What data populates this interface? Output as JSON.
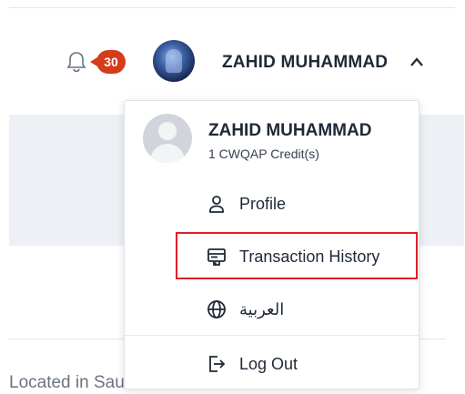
{
  "header": {
    "notification_count": "30",
    "user_name": "ZAHID MUHAMMAD"
  },
  "dropdown": {
    "user_name": "ZAHID MUHAMMAD",
    "credits": "1 CWQAP Credit(s)",
    "items": [
      {
        "label": "Profile",
        "icon": "person-icon"
      },
      {
        "label": "Transaction History",
        "icon": "receipt-icon",
        "highlighted": true
      },
      {
        "label": "العربية",
        "icon": "globe-icon"
      },
      {
        "label": "Log Out",
        "icon": "logout-icon"
      }
    ]
  },
  "background": {
    "location_text": "Located in Saudi Arabia"
  },
  "colors": {
    "badge": "#d63b1a",
    "highlight_border": "#e11d2a",
    "panel_band": "#edf1f5"
  }
}
